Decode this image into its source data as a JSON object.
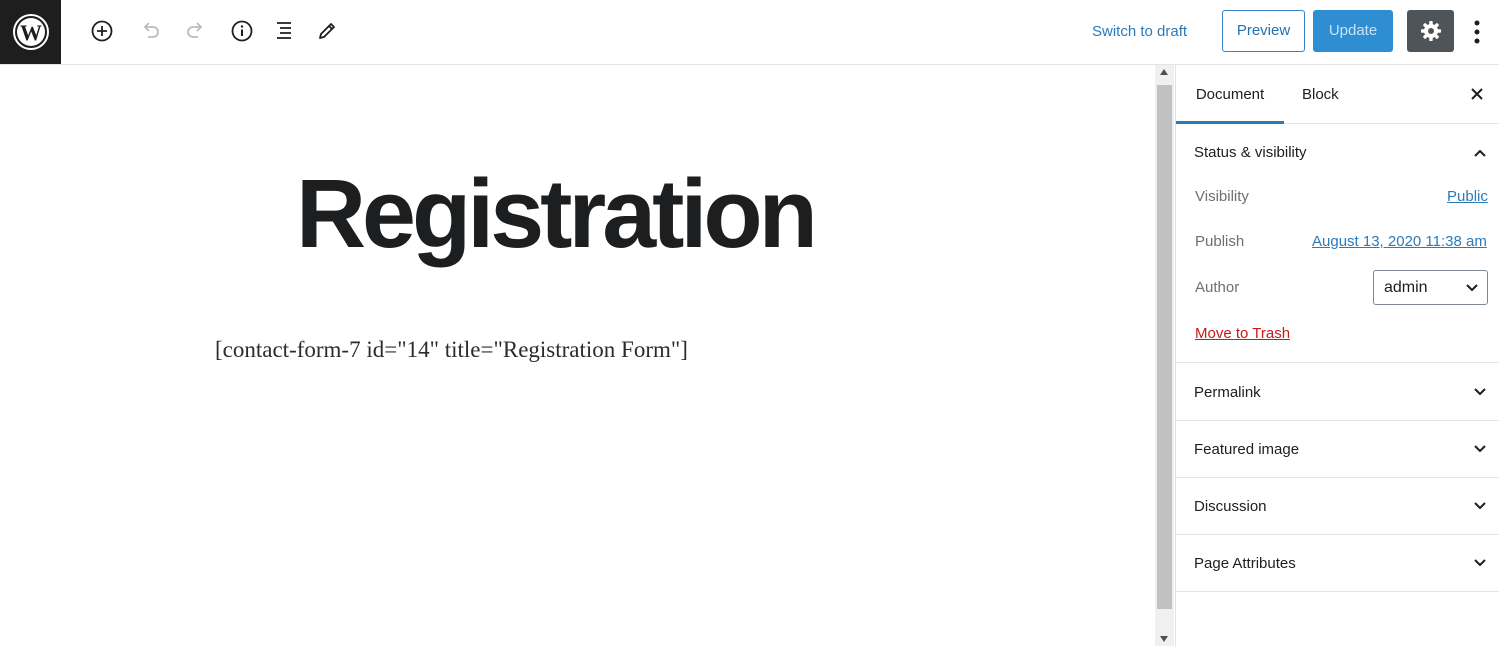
{
  "toolbar": {
    "switch_to_draft": "Switch to draft",
    "preview": "Preview",
    "update": "Update",
    "icons": [
      "wordpress-icon",
      "add-block-icon",
      "undo-icon",
      "redo-icon",
      "info-icon",
      "outline-icon",
      "edit-icon",
      "settings-icon",
      "more-icon"
    ]
  },
  "editor": {
    "title": "Registration",
    "content": "[contact-form-7 id=\"14\" title=\"Registration Form\"]"
  },
  "sidebar": {
    "tabs": [
      "Document",
      "Block"
    ],
    "active_tab": "Document",
    "status_visibility": {
      "title": "Status & visibility",
      "visibility_label": "Visibility",
      "visibility_value": "Public",
      "publish_label": "Publish",
      "publish_value": "August 13, 2020 11:38 am",
      "author_label": "Author",
      "author_value": "admin",
      "trash": "Move to Trash"
    },
    "panels": [
      "Permalink",
      "Featured image",
      "Discussion",
      "Page Attributes"
    ]
  },
  "colors": {
    "accent": "#2b7bb9",
    "update_bg": "#2f8ed2",
    "settings_bg": "#4f5458",
    "danger": "#cc1818"
  }
}
